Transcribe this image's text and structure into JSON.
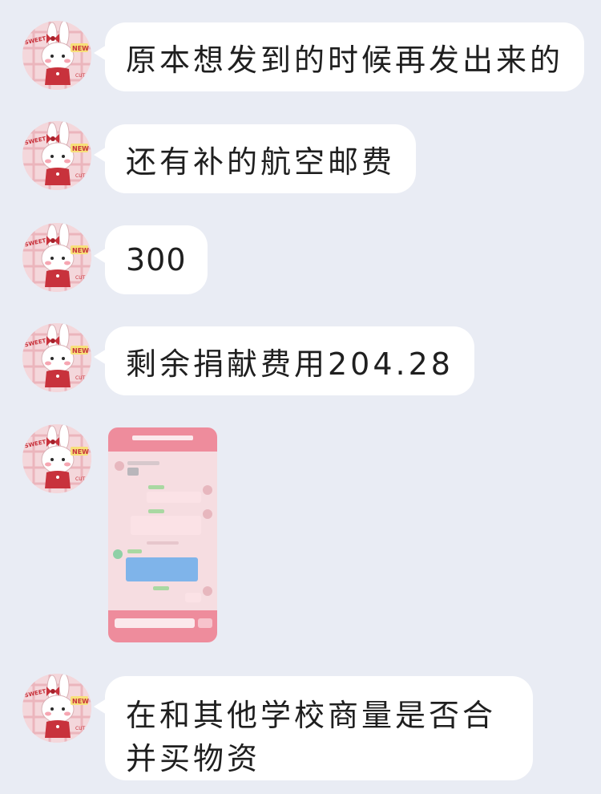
{
  "messages": [
    {
      "type": "text",
      "text": "原本想发到的时候再发出来的"
    },
    {
      "type": "text",
      "text": "还有补的航空邮费"
    },
    {
      "type": "text",
      "text": "300"
    },
    {
      "type": "text",
      "text": "剩余捐献费用204.28"
    },
    {
      "type": "image",
      "description": ""
    },
    {
      "type": "text",
      "text": "在和其他学校商量是否合并买物资"
    }
  ],
  "avatar": {
    "icon": "bunny-avatar-icon",
    "badge_texts": [
      "SWEET",
      "NEW",
      "CUT"
    ]
  },
  "colors": {
    "background": "#e9ecf4",
    "bubble": "#ffffff",
    "avatar_pink": "#f3d6da",
    "accent_red": "#c8323c"
  }
}
